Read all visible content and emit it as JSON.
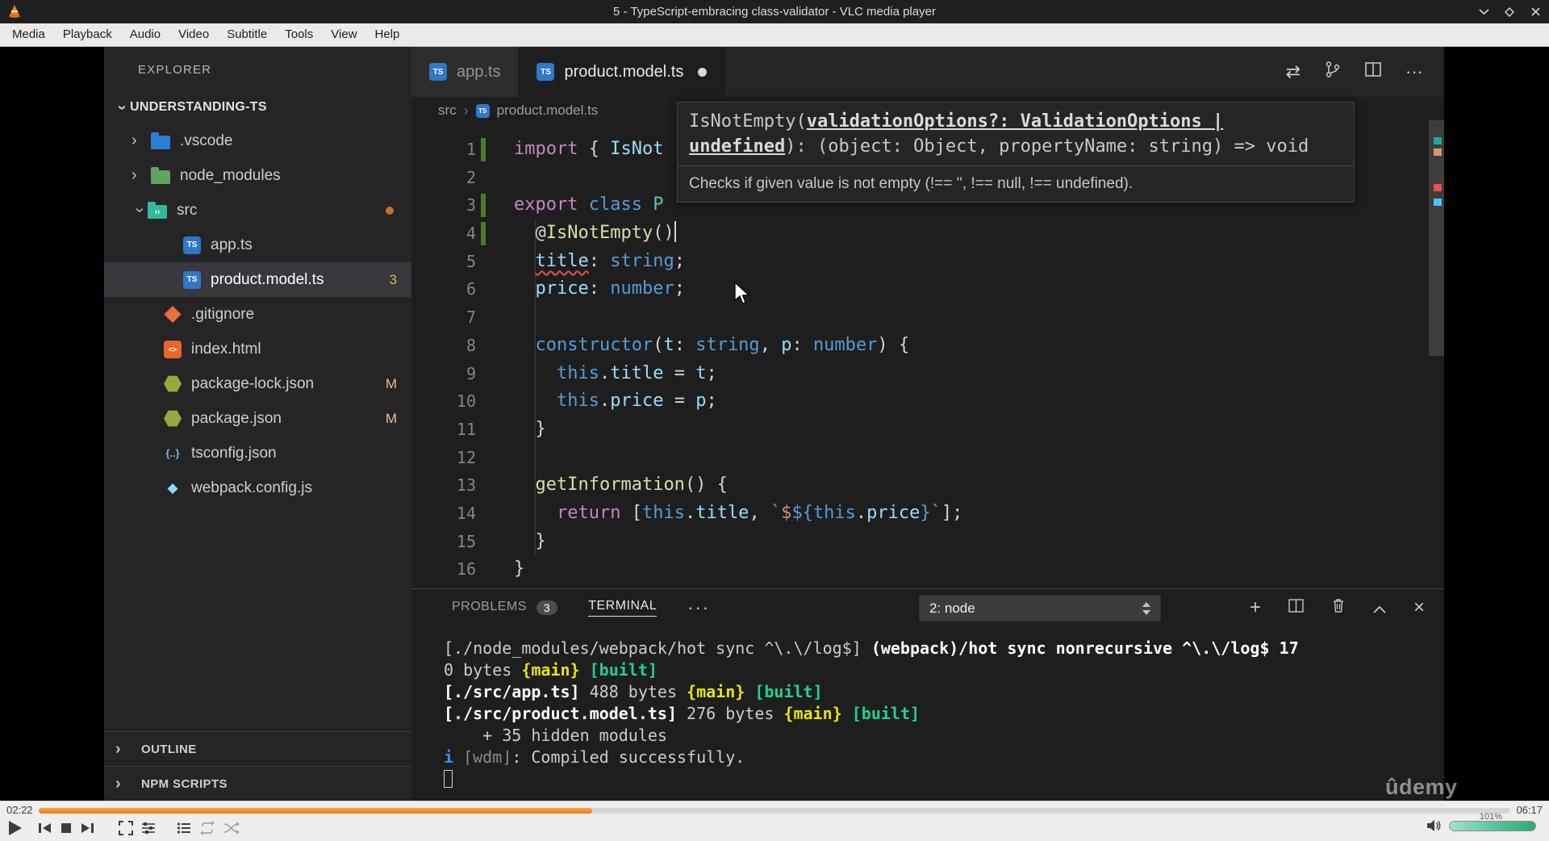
{
  "window": {
    "title": "5 - TypeScript-embracing class-validator - VLC media player",
    "menu_items": [
      "Media",
      "Playback",
      "Audio",
      "Video",
      "Subtitle",
      "Tools",
      "View",
      "Help"
    ],
    "window_controls": [
      "minimize",
      "maximize",
      "close"
    ]
  },
  "player": {
    "time_current": "02:22",
    "time_total": "06:17",
    "progress_percent": 37.6,
    "volume_label": "101%",
    "controls": [
      "play",
      "previous",
      "stop",
      "next",
      "fullscreen",
      "extended-settings",
      "playlist",
      "loop",
      "random",
      "volume"
    ]
  },
  "vscode": {
    "explorer": {
      "header": "EXPLORER",
      "root": "UNDERSTANDING-TS",
      "items": [
        {
          "label": ".vscode",
          "icon": "folder-vscode",
          "type": "folder",
          "chevron": ">",
          "indent": 1
        },
        {
          "label": "node_modules",
          "icon": "folder-node",
          "type": "folder",
          "chevron": ">",
          "indent": 1
        },
        {
          "label": "src",
          "icon": "folder-src",
          "type": "folder",
          "chevron": "v",
          "indent": 1,
          "dot": true
        },
        {
          "label": "app.ts",
          "icon": "ts",
          "indent": 2
        },
        {
          "label": "product.model.ts",
          "icon": "ts",
          "indent": 2,
          "selected": true,
          "badge": "3"
        },
        {
          "label": ".gitignore",
          "icon": "git",
          "indent": 1
        },
        {
          "label": "index.html",
          "icon": "html",
          "indent": 1
        },
        {
          "label": "package-lock.json",
          "icon": "npm",
          "indent": 1,
          "badge": "M"
        },
        {
          "label": "package.json",
          "icon": "npm",
          "indent": 1,
          "badge": "M"
        },
        {
          "label": "tsconfig.json",
          "icon": "braces",
          "indent": 1
        },
        {
          "label": "webpack.config.js",
          "icon": "webpack",
          "indent": 1
        }
      ],
      "sections": [
        "OUTLINE",
        "NPM SCRIPTS"
      ]
    },
    "editor": {
      "tabs": [
        {
          "label": "app.ts",
          "active": false,
          "modified": false
        },
        {
          "label": "product.model.ts",
          "active": true,
          "modified": true
        }
      ],
      "actions": [
        "compare-changes",
        "source-control",
        "split-editor",
        "more-actions"
      ],
      "breadcrumb": [
        "src",
        "product.model.ts"
      ],
      "tooltip": {
        "sig_pre": "IsNotEmpty(",
        "sig_param": "validationOptions?: ValidationOptions | undefined",
        "sig_post": "): (object: Object, propertyName: string) => void",
        "doc": "Checks if given value is not empty (!== '', !== null, !== undefined)."
      },
      "code_lines": [
        {
          "n": 1,
          "changed": true,
          "tokens": [
            [
              "import",
              "kw"
            ],
            [
              " { ",
              "punc"
            ],
            [
              "IsNot",
              "prop"
            ]
          ]
        },
        {
          "n": 2,
          "tokens": []
        },
        {
          "n": 3,
          "changed": true,
          "tokens": [
            [
              "export",
              "kw"
            ],
            [
              " ",
              "punc"
            ],
            [
              "class",
              "type"
            ],
            [
              " ",
              "punc"
            ],
            [
              "P",
              "class"
            ]
          ]
        },
        {
          "n": 4,
          "changed": true,
          "caret": true,
          "tokens": [
            [
              "  @",
              "punc"
            ],
            [
              "IsNotEmpty",
              "fn"
            ],
            [
              "()",
              "punc"
            ]
          ]
        },
        {
          "n": 5,
          "tokens": [
            [
              "  ",
              "punc"
            ],
            [
              "title",
              "prop-err"
            ],
            [
              ": ",
              "punc"
            ],
            [
              "string",
              "type"
            ],
            [
              ";",
              "punc"
            ]
          ]
        },
        {
          "n": 6,
          "tokens": [
            [
              "  ",
              "punc"
            ],
            [
              "price",
              "prop"
            ],
            [
              ": ",
              "punc"
            ],
            [
              "number",
              "type"
            ],
            [
              ";",
              "punc"
            ]
          ]
        },
        {
          "n": 7,
          "tokens": []
        },
        {
          "n": 8,
          "tokens": [
            [
              "  ",
              "punc"
            ],
            [
              "constructor",
              "type"
            ],
            [
              "(",
              "punc"
            ],
            [
              "t",
              "prop"
            ],
            [
              ": ",
              "punc"
            ],
            [
              "string",
              "type"
            ],
            [
              ", ",
              "punc"
            ],
            [
              "p",
              "prop"
            ],
            [
              ": ",
              "punc"
            ],
            [
              "number",
              "type"
            ],
            [
              ") {",
              "punc"
            ]
          ]
        },
        {
          "n": 9,
          "tokens": [
            [
              "    ",
              "punc"
            ],
            [
              "this",
              "type"
            ],
            [
              ".",
              "punc"
            ],
            [
              "title",
              "prop"
            ],
            [
              " = ",
              "punc"
            ],
            [
              "t",
              "prop"
            ],
            [
              ";",
              "punc"
            ]
          ]
        },
        {
          "n": 10,
          "tokens": [
            [
              "    ",
              "punc"
            ],
            [
              "this",
              "type"
            ],
            [
              ".",
              "punc"
            ],
            [
              "price",
              "prop"
            ],
            [
              " = ",
              "punc"
            ],
            [
              "p",
              "prop"
            ],
            [
              ";",
              "punc"
            ]
          ]
        },
        {
          "n": 11,
          "tokens": [
            [
              "  }",
              "punc"
            ]
          ]
        },
        {
          "n": 12,
          "tokens": []
        },
        {
          "n": 13,
          "tokens": [
            [
              "  ",
              "punc"
            ],
            [
              "getInformation",
              "fn"
            ],
            [
              "() {",
              "punc"
            ]
          ]
        },
        {
          "n": 14,
          "tokens": [
            [
              "    ",
              "punc"
            ],
            [
              "return",
              "kw"
            ],
            [
              " [",
              "punc"
            ],
            [
              "this",
              "type"
            ],
            [
              ".",
              "punc"
            ],
            [
              "title",
              "prop"
            ],
            [
              ", ",
              "punc"
            ],
            [
              "`$",
              "str"
            ],
            [
              "${",
              "type"
            ],
            [
              "this",
              "type"
            ],
            [
              ".",
              "punc"
            ],
            [
              "price",
              "prop"
            ],
            [
              "}",
              "type"
            ],
            [
              "`",
              "str"
            ],
            [
              "];",
              "punc"
            ]
          ]
        },
        {
          "n": 15,
          "tokens": [
            [
              "  }",
              "punc"
            ]
          ]
        },
        {
          "n": 16,
          "tokens": [
            [
              "}",
              "punc"
            ]
          ]
        }
      ]
    },
    "panel": {
      "tabs": [
        {
          "label": "PROBLEMS",
          "badge": "3",
          "active": false
        },
        {
          "label": "TERMINAL",
          "active": true
        }
      ],
      "more_label": "···",
      "dropdown_value": "2: node",
      "actions": [
        "new-terminal",
        "split-terminal",
        "kill-terminal",
        "maximize-panel",
        "close-panel"
      ],
      "terminal_lines": [
        [
          [
            "[./node_modules/webpack/hot sync ^\\.\\/log$] ",
            "def"
          ],
          [
            "(webpack)/hot sync nonrecursive ^\\.\\/log$ 17",
            "bold"
          ]
        ],
        [
          [
            "0 bytes ",
            "def"
          ],
          [
            "{main}",
            "yellow"
          ],
          [
            " ",
            "def"
          ],
          [
            "[built]",
            "green"
          ]
        ],
        [
          [
            "[./src/app.ts]",
            "bold"
          ],
          [
            " 488 bytes ",
            "def"
          ],
          [
            "{main}",
            "yellow"
          ],
          [
            " ",
            "def"
          ],
          [
            "[built]",
            "green"
          ]
        ],
        [
          [
            "[./src/product.model.ts]",
            "bold"
          ],
          [
            " 276 bytes ",
            "def"
          ],
          [
            "{main}",
            "yellow"
          ],
          [
            " ",
            "def"
          ],
          [
            "[built]",
            "green"
          ]
        ],
        [
          [
            "    + 35 hidden modules",
            "def"
          ]
        ],
        [
          [
            "i ",
            "blue"
          ],
          [
            "⌈wdm⌋",
            "gray"
          ],
          [
            ": Compiled successfully.",
            "def"
          ]
        ]
      ]
    },
    "watermark": "ûdemy"
  }
}
